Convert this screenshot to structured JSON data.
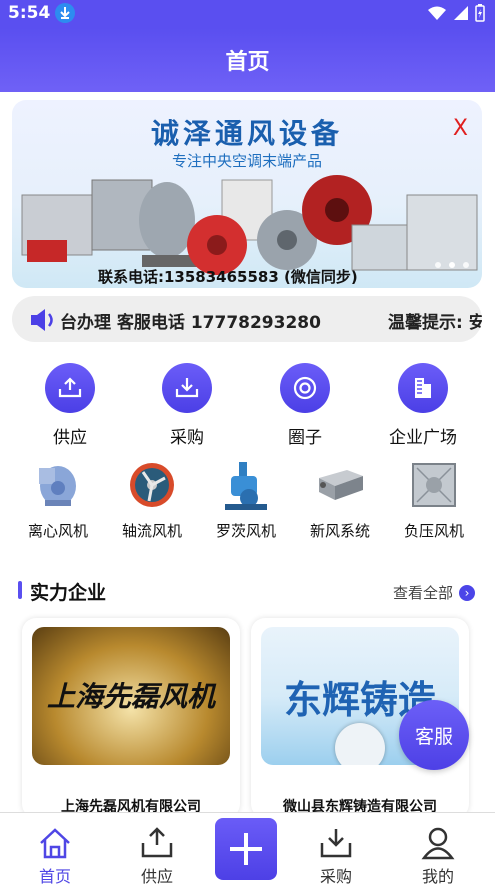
{
  "status": {
    "time": "5:54"
  },
  "header": {
    "title": "首页"
  },
  "banner": {
    "title": "诚泽通风设备",
    "subtitle": "专注中央空调末端产品",
    "close_label": "X",
    "phone": "联系电话:13583465583 (微信同步)"
  },
  "notice": {
    "text": "台办理 客服电话 17778293280",
    "text2": "温馨提示: 安"
  },
  "quick_actions": [
    {
      "label": "供应",
      "icon": "upload-tray-icon"
    },
    {
      "label": "采购",
      "icon": "download-tray-icon"
    },
    {
      "label": "圈子",
      "icon": "target-icon"
    },
    {
      "label": "企业广场",
      "icon": "building-icon"
    }
  ],
  "categories": [
    {
      "label": "离心风机",
      "icon": "centrifugal-fan-icon"
    },
    {
      "label": "轴流风机",
      "icon": "axial-fan-icon"
    },
    {
      "label": "罗茨风机",
      "icon": "roots-blower-icon"
    },
    {
      "label": "新风系统",
      "icon": "fresh-air-unit-icon"
    },
    {
      "label": "负压风机",
      "icon": "negative-pressure-fan-icon"
    }
  ],
  "section": {
    "title": "实力企业",
    "view_all": "查看全部"
  },
  "companies": [
    {
      "name": "上海先磊风机有限公司",
      "image_text": "上海先磊风机"
    },
    {
      "name": "微山县东辉铸造有限公司",
      "image_text": "东辉铸造"
    }
  ],
  "float_service": {
    "label": "客服"
  },
  "tabbar": {
    "items": [
      {
        "label": "首页"
      },
      {
        "label": "供应"
      },
      {
        "label": "采购"
      },
      {
        "label": "我的"
      }
    ]
  },
  "colors": {
    "primary": "#5a4ff0",
    "accent": "#4f46e5",
    "close": "#e02020"
  }
}
